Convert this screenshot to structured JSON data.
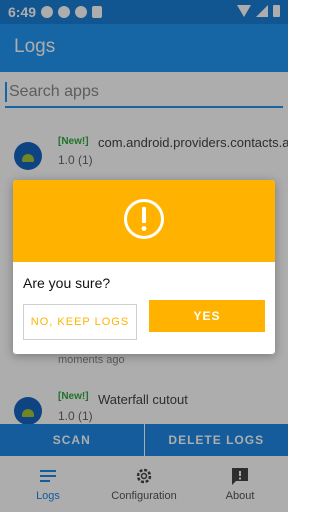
{
  "status_bar": {
    "time": "6:49"
  },
  "app_bar": {
    "title": "Logs"
  },
  "search": {
    "placeholder": "Search apps"
  },
  "list": [
    {
      "badge": "[New!]",
      "app_name": "com.android.providers.contacts.au",
      "version": "1.0 (1)"
    },
    {
      "badge": "[New!]",
      "app_name": "Waterfall cutout",
      "version": "1.0 (1)"
    }
  ],
  "partial_time": "moments ago",
  "dialog": {
    "question": "Are you sure?",
    "no_label": "NO, KEEP LOGS",
    "yes_label": "YES",
    "header_color": "#ffb300"
  },
  "action_bar": {
    "scan_label": "SCAN",
    "delete_label": "DELETE LOGS"
  },
  "bottom_nav": {
    "items": [
      {
        "label": "Logs",
        "icon": "list-icon"
      },
      {
        "label": "Configuration",
        "icon": "gear-icon"
      },
      {
        "label": "About",
        "icon": "info-icon"
      }
    ]
  },
  "colors": {
    "primary": "#2196f3",
    "accent": "#ffb300",
    "badge": "#2eaa3c"
  }
}
